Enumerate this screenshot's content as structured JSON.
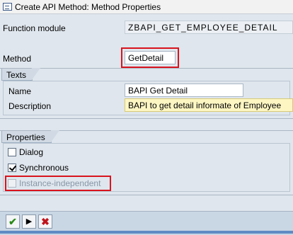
{
  "window": {
    "title": "Create API Method: Method Properties"
  },
  "form": {
    "function_module_label": "Function module",
    "function_module_value": "ZBAPI_GET_EMPLOYEE_DETAIL",
    "method_label": "Method",
    "method_value": "GetDetail"
  },
  "texts": {
    "group_title": "Texts",
    "name_label": "Name",
    "name_value": "BAPI Get Detail",
    "description_label": "Description",
    "description_value": "BAPI to get detail informate of Employee"
  },
  "properties": {
    "group_title": "Properties",
    "dialog_label": "Dialog",
    "dialog_checked": false,
    "synchronous_label": "Synchronous",
    "synchronous_checked": true,
    "instance_independent_label": "Instance-independent",
    "instance_independent_checked": false,
    "instance_independent_enabled": false
  },
  "toolbar": {
    "continue_icon": "check-icon",
    "next_icon": "triangle-right-icon",
    "cancel_icon": "cross-icon"
  },
  "colors": {
    "highlight": "#d9141e",
    "accent_bar": "#5f8ac4"
  }
}
